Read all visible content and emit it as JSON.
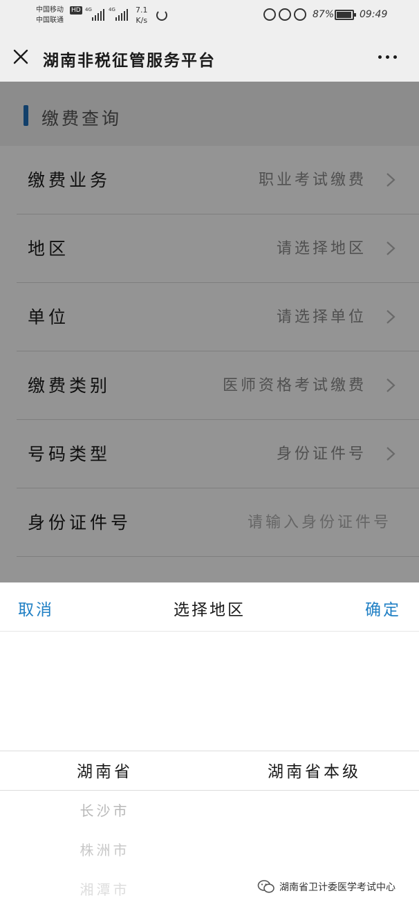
{
  "status_bar": {
    "carrier_1": "中国移动",
    "carrier_2": "中国联通",
    "hd_badge": "HD",
    "signal_1": "4G",
    "signal_2": "4G",
    "net_speed_value": "7.1",
    "net_speed_unit": "K/s",
    "battery_percent": "87%",
    "time": "09:49"
  },
  "header": {
    "title": "湖南非税征管服务平台"
  },
  "section": {
    "title": "缴费查询"
  },
  "form_rows": [
    {
      "label": "缴费业务",
      "value": "职业考试缴费"
    },
    {
      "label": "地区",
      "value": "请选择地区"
    },
    {
      "label": "单位",
      "value": "请选择单位"
    },
    {
      "label": "缴费类别",
      "value": "医师资格考试缴费"
    },
    {
      "label": "号码类型",
      "value": "身份证件号"
    },
    {
      "label": "身份证件号",
      "placeholder": "请输入身份证件号"
    }
  ],
  "picker": {
    "cancel_label": "取消",
    "title": "选择地区",
    "confirm_label": "确定",
    "province_selected": "湖南省",
    "province_options": [
      "长沙市",
      "株洲市",
      "湘潭市"
    ],
    "level_selected": "湖南省本级"
  },
  "watermark": {
    "text": "湖南省卫计委医学考试中心"
  },
  "colors": {
    "accent": "#1f7fc4",
    "section_bar": "#1f6fb8"
  }
}
